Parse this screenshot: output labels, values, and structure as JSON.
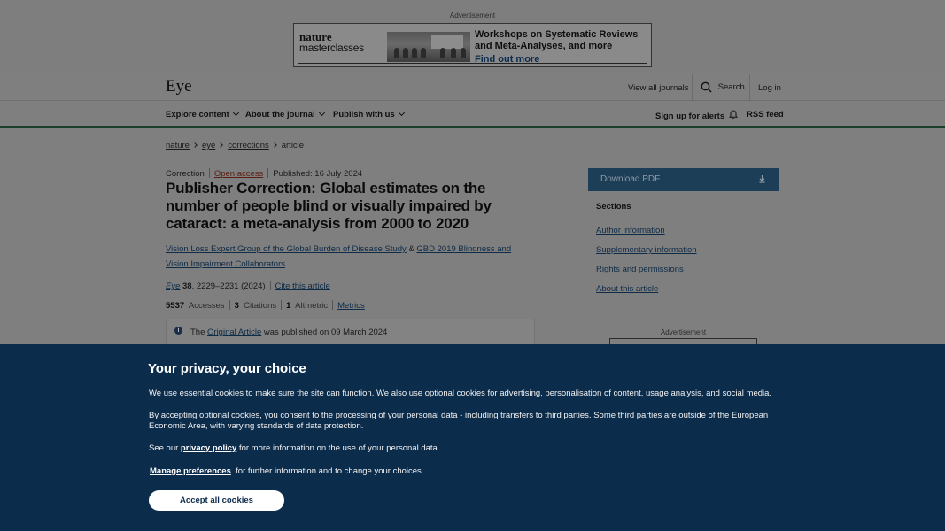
{
  "advertisement": {
    "label": "Advertisement",
    "logo_line1": "nature",
    "logo_line2": "masterclasses",
    "headline": "Workshops on Systematic Reviews and Meta-Analyses, and more",
    "cta": "Find out more"
  },
  "header": {
    "brand": "Eye",
    "view_all": "View all journals",
    "search": "Search",
    "login": "Log in"
  },
  "nav": {
    "explore": "Explore content",
    "about": "About the journal",
    "publish": "Publish with us",
    "alerts": "Sign up for alerts",
    "rss": "RSS feed"
  },
  "breadcrumb": [
    "nature",
    "eye",
    "corrections",
    "article"
  ],
  "article": {
    "type": "Correction",
    "access": "Open access",
    "published": "Published: 16 July 2024",
    "title": "Publisher Correction: Global estimates on the number of people blind or visually impaired by cataract: a meta-analysis from 2000 to 2020",
    "author1": "Vision Loss Expert Group of the Global Burden of Disease Study",
    "amp": "&",
    "author2": "GBD 2019 Blindness and Vision Impairment Collaborators",
    "journal": "Eye",
    "volume": "38",
    "pages": ", 2229–2231 (2024)",
    "cite": "Cite this article",
    "accesses_count": "5537",
    "accesses_label": "Accesses",
    "citations_count": "3",
    "citations_label": "Citations",
    "altmetric_count": "1",
    "altmetric_label": "Altmetric",
    "metrics": "Metrics",
    "notice_prefix": "The",
    "notice_link": "Original Article",
    "notice_suffix": "was published on 09 March 2024"
  },
  "sidebar": {
    "download": "Download PDF",
    "sections_title": "Sections",
    "sections": [
      "Author information",
      "Supplementary information",
      "Rights and permissions",
      "About this article"
    ],
    "ad_label": "Advertisement"
  },
  "cookie": {
    "title": "Your privacy, your choice",
    "p1": "We use essential cookies to make sure the site can function. We also use optional cookies for advertising, personalisation of content, usage analysis, and social media.",
    "p2": "By accepting optional cookies, you consent to the processing of your personal data - including transfers to third parties. Some third parties are outside of the European Economic Area, with varying standards of data protection.",
    "p3_prefix": "See our",
    "p3_link": "privacy policy",
    "p3_suffix": "for more information on the use of your personal data.",
    "p4_link": "Manage preferences",
    "p4_suffix": "for further information and to change your choices.",
    "accept": "Accept all cookies"
  }
}
